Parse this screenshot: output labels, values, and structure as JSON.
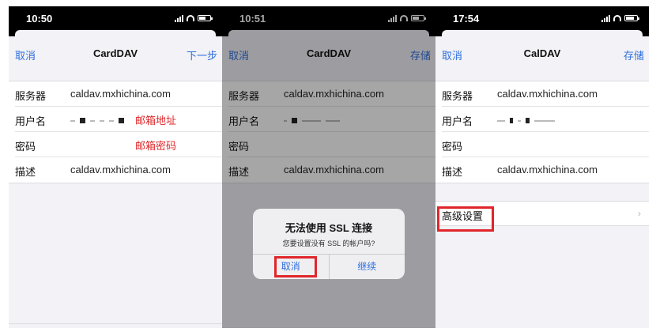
{
  "screens": [
    {
      "time": "10:50",
      "nav": {
        "left": "取消",
        "title": "CardDAV",
        "right": "下一步"
      },
      "rows": [
        {
          "label": "服务器",
          "value": "caldav.mxhichina.com"
        },
        {
          "label": "用户名",
          "value": "",
          "hint": "邮箱地址"
        },
        {
          "label": "密码",
          "value": "",
          "hint": "邮箱密码"
        },
        {
          "label": "描述",
          "value": "caldav.mxhichina.com"
        }
      ]
    },
    {
      "time": "10:51",
      "nav": {
        "left": "取消",
        "title": "CardDAV",
        "right": "存储"
      },
      "rows": [
        {
          "label": "服务器",
          "value": "caldav.mxhichina.com"
        },
        {
          "label": "用户名",
          "value": ""
        },
        {
          "label": "密码",
          "value": ""
        },
        {
          "label": "描述",
          "value": "caldav.mxhichina.com"
        }
      ],
      "alert": {
        "title": "无法使用 SSL 连接",
        "message": "您要设置没有 SSL 的帐户吗?",
        "cancel": "取消",
        "continue": "继续"
      }
    },
    {
      "time": "17:54",
      "nav": {
        "left": "取消",
        "title": "CalDAV",
        "right": "存储"
      },
      "rows": [
        {
          "label": "服务器",
          "value": "caldav.mxhichina.com"
        },
        {
          "label": "用户名",
          "value": ""
        },
        {
          "label": "密码",
          "value": ""
        },
        {
          "label": "描述",
          "value": "caldav.mxhichina.com"
        }
      ],
      "advanced": {
        "label": "高级设置",
        "chevron": "›"
      }
    }
  ],
  "colors": {
    "link": "#2f6fde",
    "annotation": "#e0262a",
    "background": "#f2f2f7"
  },
  "icons": [
    "signal-icon",
    "wifi-icon",
    "battery-icon",
    "chevron-right-icon"
  ]
}
